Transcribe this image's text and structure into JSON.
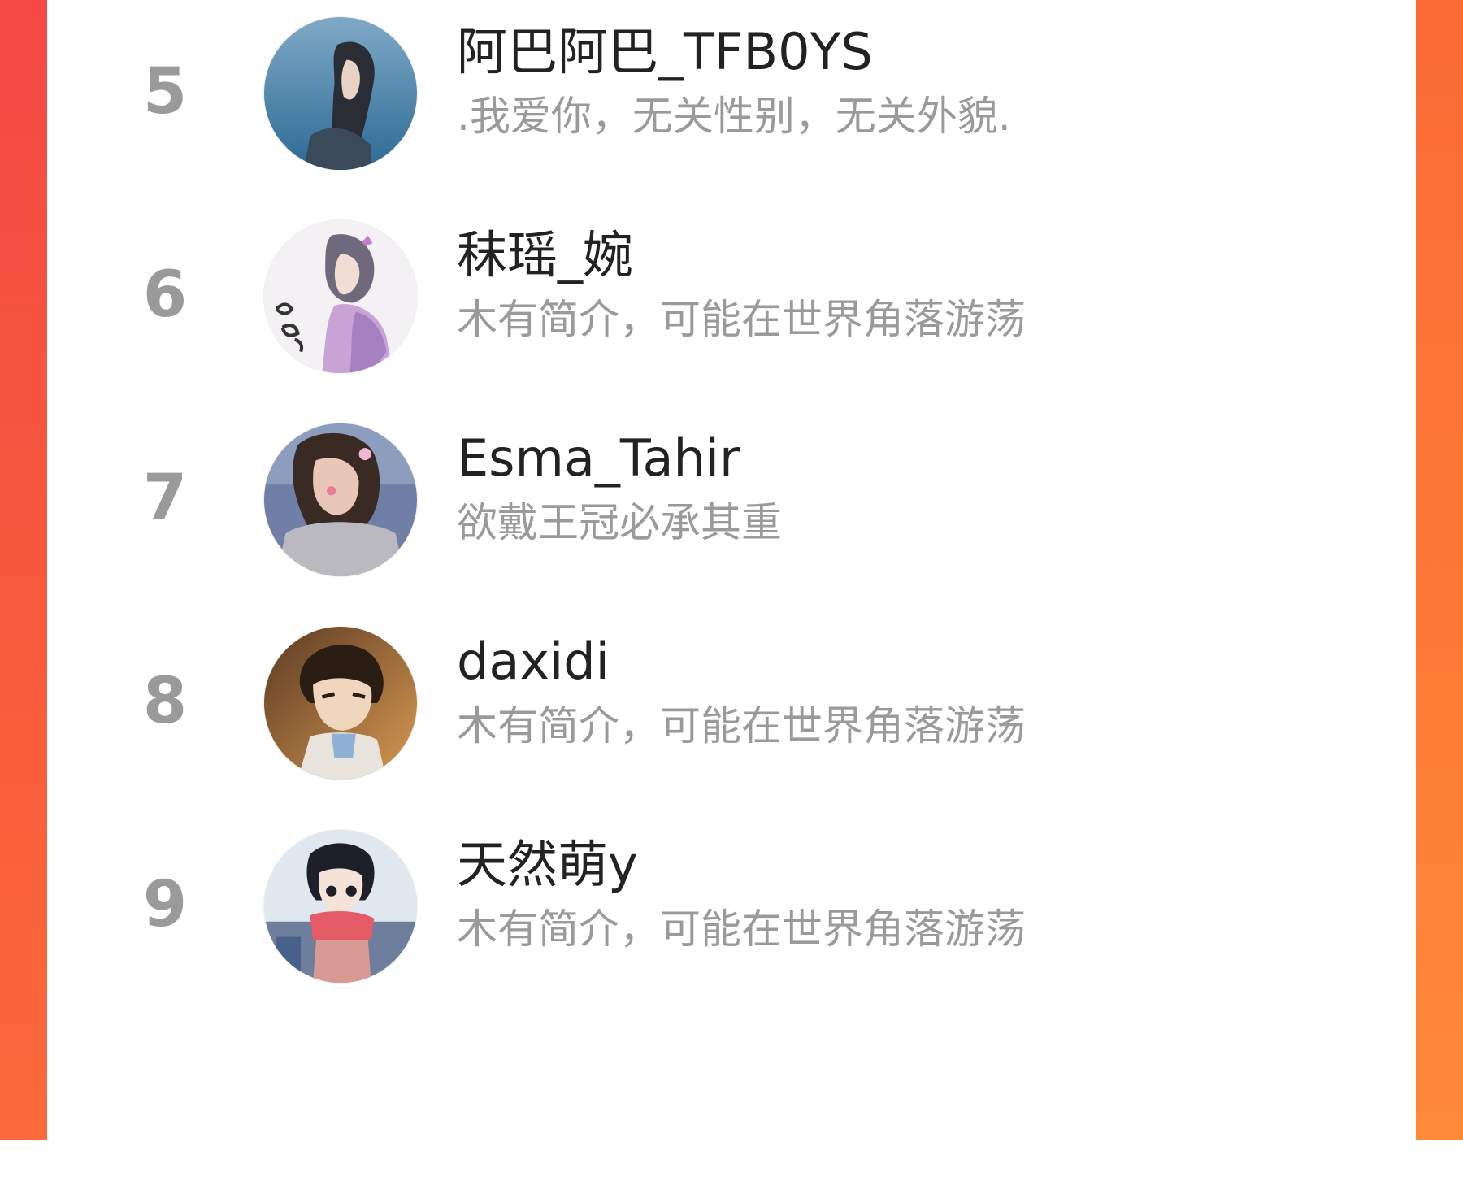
{
  "leaderboard": {
    "items": [
      {
        "rank": "5",
        "name": "阿巴阿巴_TFB0YS",
        "bio": ".我爱你，无关性别，无关外貌.",
        "avatar_icon": "avatar-girl-sea-icon"
      },
      {
        "rank": "6",
        "name": "秣瑶_婉",
        "bio": "木有简介，可能在世界角落游荡",
        "avatar_icon": "avatar-anime-girl-calligraphy-icon"
      },
      {
        "rank": "7",
        "name": "Esma_Tahir",
        "bio": "欲戴王冠必承其重",
        "avatar_icon": "avatar-selfie-girl-icon"
      },
      {
        "rank": "8",
        "name": "daxidi",
        "bio": "木有简介，可能在世界角落游荡",
        "avatar_icon": "avatar-anime-boy-icon"
      },
      {
        "rank": "9",
        "name": "天然萌y",
        "bio": "木有简介，可能在世界角落游荡",
        "avatar_icon": "avatar-anime-girl-scarf-icon"
      }
    ]
  },
  "colors": {
    "frame_left": "#f44945",
    "frame_right": "#fb6b36",
    "rank_text": "#9a9a9a",
    "name_text": "#222222",
    "bio_text": "#9a9a9a"
  }
}
